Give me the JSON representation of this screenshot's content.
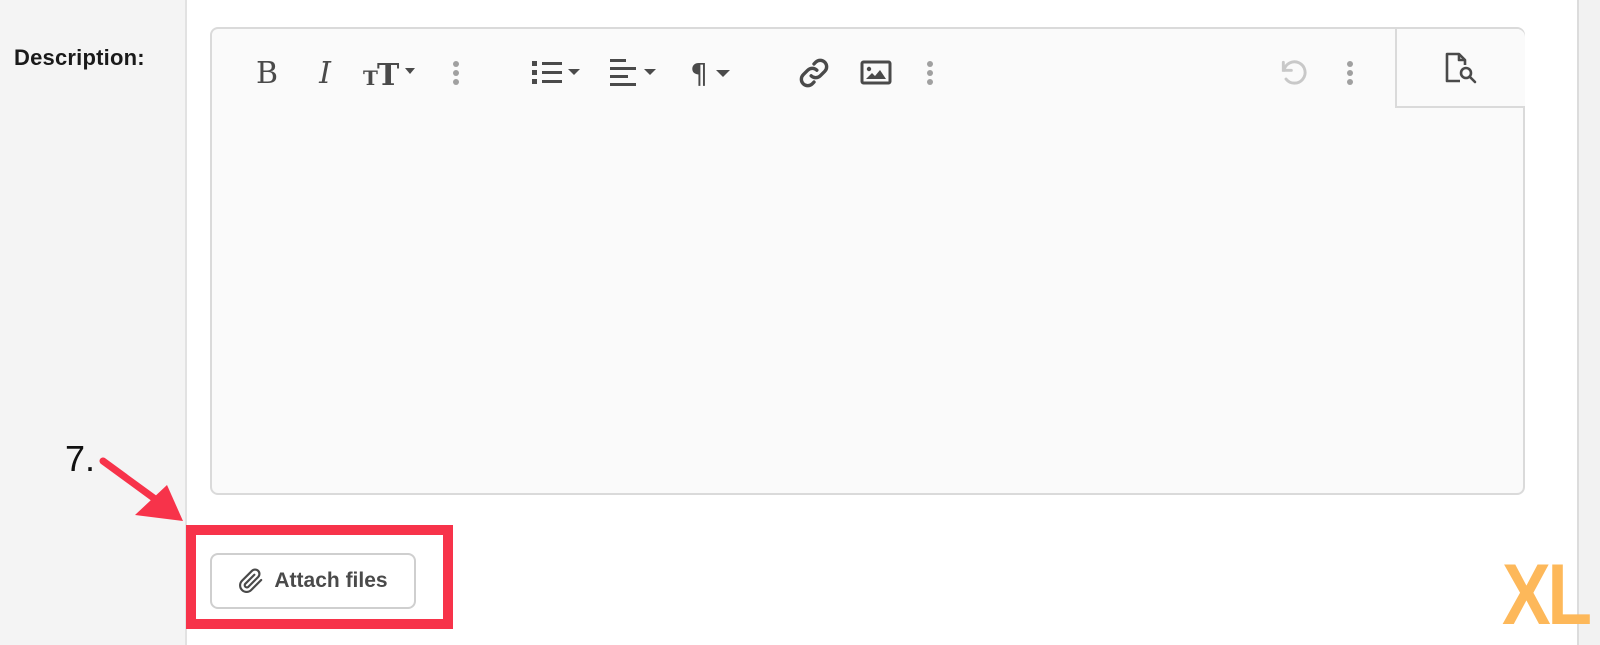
{
  "form": {
    "description_label": "Description:"
  },
  "editor": {
    "toolbar": [
      {
        "name": "bold",
        "icon": "bold-icon",
        "glyph": "B"
      },
      {
        "name": "italic",
        "icon": "italic-icon",
        "glyph": "I"
      },
      {
        "name": "text-size",
        "icon": "text-size-icon",
        "has_dropdown": true
      },
      {
        "name": "more-text",
        "icon": "more-vertical-icon"
      },
      {
        "name": "bulleted-list",
        "icon": "bulleted-list-icon",
        "has_dropdown": true
      },
      {
        "name": "align",
        "icon": "align-left-icon",
        "has_dropdown": true
      },
      {
        "name": "paragraph",
        "icon": "paragraph-icon",
        "glyph": "¶",
        "has_dropdown": true
      },
      {
        "name": "link",
        "icon": "link-icon"
      },
      {
        "name": "image",
        "icon": "image-icon"
      },
      {
        "name": "more-insert",
        "icon": "more-vertical-icon"
      },
      {
        "name": "undo",
        "icon": "undo-icon",
        "disabled": true
      },
      {
        "name": "more-history",
        "icon": "more-vertical-icon"
      },
      {
        "name": "preview",
        "icon": "preview-document-icon"
      }
    ],
    "content": ""
  },
  "attach": {
    "label": "Attach files",
    "icon": "paperclip-icon"
  },
  "annotation": {
    "step_label": "7.",
    "highlight_color": "#f7334a"
  },
  "watermark": {
    "text": "XL",
    "color": "#fdb85a"
  }
}
